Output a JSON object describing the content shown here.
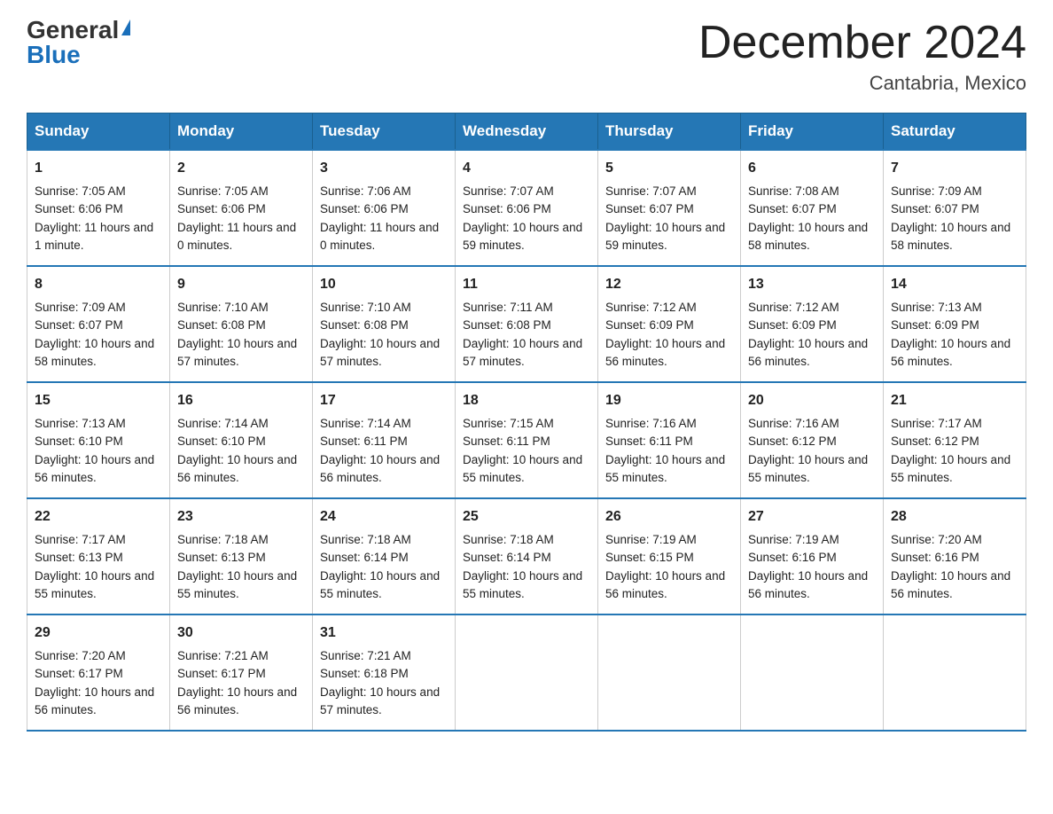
{
  "logo": {
    "general": "General",
    "blue": "Blue"
  },
  "title": "December 2024",
  "location": "Cantabria, Mexico",
  "days": [
    "Sunday",
    "Monday",
    "Tuesday",
    "Wednesday",
    "Thursday",
    "Friday",
    "Saturday"
  ],
  "weeks": [
    [
      {
        "day": "1",
        "sunrise": "7:05 AM",
        "sunset": "6:06 PM",
        "daylight": "11 hours and 1 minute."
      },
      {
        "day": "2",
        "sunrise": "7:05 AM",
        "sunset": "6:06 PM",
        "daylight": "11 hours and 0 minutes."
      },
      {
        "day": "3",
        "sunrise": "7:06 AM",
        "sunset": "6:06 PM",
        "daylight": "11 hours and 0 minutes."
      },
      {
        "day": "4",
        "sunrise": "7:07 AM",
        "sunset": "6:06 PM",
        "daylight": "10 hours and 59 minutes."
      },
      {
        "day": "5",
        "sunrise": "7:07 AM",
        "sunset": "6:07 PM",
        "daylight": "10 hours and 59 minutes."
      },
      {
        "day": "6",
        "sunrise": "7:08 AM",
        "sunset": "6:07 PM",
        "daylight": "10 hours and 58 minutes."
      },
      {
        "day": "7",
        "sunrise": "7:09 AM",
        "sunset": "6:07 PM",
        "daylight": "10 hours and 58 minutes."
      }
    ],
    [
      {
        "day": "8",
        "sunrise": "7:09 AM",
        "sunset": "6:07 PM",
        "daylight": "10 hours and 58 minutes."
      },
      {
        "day": "9",
        "sunrise": "7:10 AM",
        "sunset": "6:08 PM",
        "daylight": "10 hours and 57 minutes."
      },
      {
        "day": "10",
        "sunrise": "7:10 AM",
        "sunset": "6:08 PM",
        "daylight": "10 hours and 57 minutes."
      },
      {
        "day": "11",
        "sunrise": "7:11 AM",
        "sunset": "6:08 PM",
        "daylight": "10 hours and 57 minutes."
      },
      {
        "day": "12",
        "sunrise": "7:12 AM",
        "sunset": "6:09 PM",
        "daylight": "10 hours and 56 minutes."
      },
      {
        "day": "13",
        "sunrise": "7:12 AM",
        "sunset": "6:09 PM",
        "daylight": "10 hours and 56 minutes."
      },
      {
        "day": "14",
        "sunrise": "7:13 AM",
        "sunset": "6:09 PM",
        "daylight": "10 hours and 56 minutes."
      }
    ],
    [
      {
        "day": "15",
        "sunrise": "7:13 AM",
        "sunset": "6:10 PM",
        "daylight": "10 hours and 56 minutes."
      },
      {
        "day": "16",
        "sunrise": "7:14 AM",
        "sunset": "6:10 PM",
        "daylight": "10 hours and 56 minutes."
      },
      {
        "day": "17",
        "sunrise": "7:14 AM",
        "sunset": "6:11 PM",
        "daylight": "10 hours and 56 minutes."
      },
      {
        "day": "18",
        "sunrise": "7:15 AM",
        "sunset": "6:11 PM",
        "daylight": "10 hours and 55 minutes."
      },
      {
        "day": "19",
        "sunrise": "7:16 AM",
        "sunset": "6:11 PM",
        "daylight": "10 hours and 55 minutes."
      },
      {
        "day": "20",
        "sunrise": "7:16 AM",
        "sunset": "6:12 PM",
        "daylight": "10 hours and 55 minutes."
      },
      {
        "day": "21",
        "sunrise": "7:17 AM",
        "sunset": "6:12 PM",
        "daylight": "10 hours and 55 minutes."
      }
    ],
    [
      {
        "day": "22",
        "sunrise": "7:17 AM",
        "sunset": "6:13 PM",
        "daylight": "10 hours and 55 minutes."
      },
      {
        "day": "23",
        "sunrise": "7:18 AM",
        "sunset": "6:13 PM",
        "daylight": "10 hours and 55 minutes."
      },
      {
        "day": "24",
        "sunrise": "7:18 AM",
        "sunset": "6:14 PM",
        "daylight": "10 hours and 55 minutes."
      },
      {
        "day": "25",
        "sunrise": "7:18 AM",
        "sunset": "6:14 PM",
        "daylight": "10 hours and 55 minutes."
      },
      {
        "day": "26",
        "sunrise": "7:19 AM",
        "sunset": "6:15 PM",
        "daylight": "10 hours and 56 minutes."
      },
      {
        "day": "27",
        "sunrise": "7:19 AM",
        "sunset": "6:16 PM",
        "daylight": "10 hours and 56 minutes."
      },
      {
        "day": "28",
        "sunrise": "7:20 AM",
        "sunset": "6:16 PM",
        "daylight": "10 hours and 56 minutes."
      }
    ],
    [
      {
        "day": "29",
        "sunrise": "7:20 AM",
        "sunset": "6:17 PM",
        "daylight": "10 hours and 56 minutes."
      },
      {
        "day": "30",
        "sunrise": "7:21 AM",
        "sunset": "6:17 PM",
        "daylight": "10 hours and 56 minutes."
      },
      {
        "day": "31",
        "sunrise": "7:21 AM",
        "sunset": "6:18 PM",
        "daylight": "10 hours and 57 minutes."
      },
      null,
      null,
      null,
      null
    ]
  ]
}
